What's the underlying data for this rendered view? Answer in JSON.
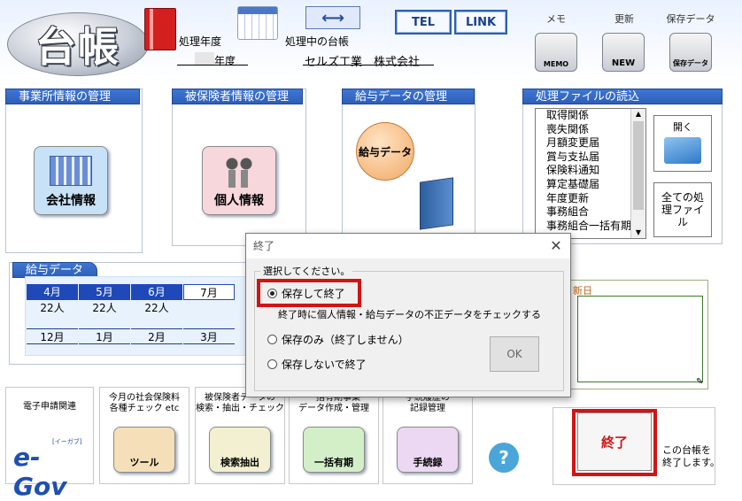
{
  "header": {
    "logo_text": "台帳",
    "processing_year_label": "処理年度",
    "processing_book_label": "処理中の台帳",
    "year_value": "年度",
    "company_name": "セルズ工業　株式会社",
    "tel_button": "TEL",
    "link_button": "LINK",
    "memo_label": "メモ",
    "memo_icon_text": "MEMO",
    "update_label": "更新",
    "update_icon_text": "NEW",
    "save_label": "保存データ",
    "save_icon_text": "保存データ"
  },
  "sections": {
    "office": {
      "title": "事業所情報の管理",
      "button": "会社情報"
    },
    "insured": {
      "title": "被保険者情報の管理",
      "button": "個人情報"
    },
    "salary": {
      "title": "給与データの管理",
      "button": "給与データ"
    },
    "files": {
      "title": "処理ファイルの読込",
      "items": [
        "取得関係",
        "喪失関係",
        "月額変更届",
        "賞与支払届",
        "保険料通知",
        "算定基礎届",
        "年度更新",
        "事務組合",
        "事務組合一括有期"
      ],
      "open_button": "開く",
      "all_files_button": "全ての処理ファイル"
    }
  },
  "salary_grid": {
    "title": "給与データ",
    "row1_months": [
      "4月",
      "5月",
      "6月",
      "7月"
    ],
    "row1_counts": [
      "22人",
      "22人",
      "22人"
    ],
    "row2_months": [
      "12月",
      "1月",
      "2月",
      "3月"
    ]
  },
  "memo_panel": {
    "label": "新日"
  },
  "dialog": {
    "title": "終了",
    "group_label": "選択してください。",
    "option_save_exit": "保存して終了",
    "check_label": "終了時に個人情報・給与データの不正データをチェックする",
    "option_save_only": "保存のみ（終了しません）",
    "option_exit_nosave": "保存しないで終了",
    "ok_button": "OK"
  },
  "bottom": {
    "egov_label": "電子申請関連",
    "egov_logo": "e-Gov",
    "egov_sub": "[イーガブ]",
    "social_check_label": "今月の社会保険料\n各種チェック etc",
    "tool_button": "ツール",
    "search_label": "被保険者データの\n検索・抽出・チェック",
    "search_button": "検索抽出",
    "batch_label": "一括有期事業\nデータ作成・管理",
    "batch_button": "一括有期",
    "procedure_label": "手続履歴の\n記録管理",
    "procedure_button": "手続録",
    "help_icon": "?",
    "exit_button": "終了",
    "exit_caption": "この台帳を\n終了します。"
  }
}
